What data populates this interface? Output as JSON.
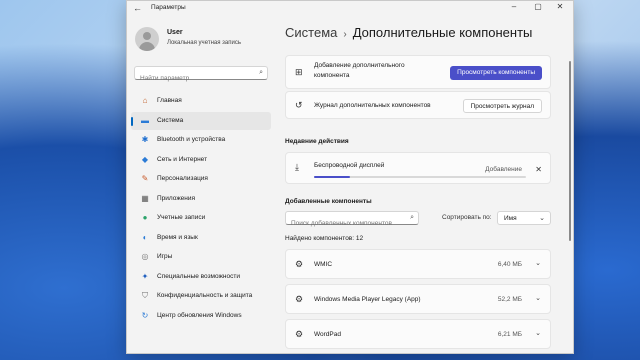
{
  "window": {
    "title": "Параметры"
  },
  "user": {
    "name": "User",
    "subtitle": "Локальная учетная запись"
  },
  "search": {
    "placeholder": "Найти параметр"
  },
  "nav": {
    "items": [
      {
        "label": "Главная",
        "icon": "home-icon",
        "glyph": "⌂",
        "color": "#c2602a"
      },
      {
        "label": "Система",
        "icon": "system-icon",
        "glyph": "▬",
        "color": "#2b7bd6",
        "active": true
      },
      {
        "label": "Bluetooth и устройства",
        "icon": "bluetooth-icon",
        "glyph": "✱",
        "color": "#1f6fd0"
      },
      {
        "label": "Сеть и Интернет",
        "icon": "wifi-icon",
        "glyph": "◆",
        "color": "#2b7bd6"
      },
      {
        "label": "Персонализация",
        "icon": "brush-icon",
        "glyph": "✎",
        "color": "#c85a2a"
      },
      {
        "label": "Приложения",
        "icon": "apps-icon",
        "glyph": "▦",
        "color": "#5a5a5a"
      },
      {
        "label": "Учетные записи",
        "icon": "accounts-icon",
        "glyph": "●",
        "color": "#2ba36b"
      },
      {
        "label": "Время и язык",
        "icon": "globe-icon",
        "glyph": "◐",
        "color": "#2b7bd6"
      },
      {
        "label": "Игры",
        "icon": "gamepad-icon",
        "glyph": "◎",
        "color": "#777777"
      },
      {
        "label": "Специальные возможности",
        "icon": "accessibility-icon",
        "glyph": "✦",
        "color": "#1f5fbf"
      },
      {
        "label": "Конфиденциальность и защита",
        "icon": "shield-icon",
        "glyph": "⛉",
        "color": "#6a6a6a"
      },
      {
        "label": "Центр обновления Windows",
        "icon": "update-icon",
        "glyph": "↻",
        "color": "#2b7bd6"
      }
    ]
  },
  "breadcrumb": {
    "parent": "Система",
    "current": "Дополнительные компоненты"
  },
  "add_card": {
    "label": "Добавление дополнительного компонента",
    "button": "Просмотреть компоненты"
  },
  "history_card": {
    "label": "Журнал дополнительных компонентов",
    "button": "Просмотреть журнал"
  },
  "recent": {
    "heading": "Недавние действия",
    "item": {
      "name": "Беспроводной дисплей",
      "status": "Добавление",
      "progress": 0.17
    }
  },
  "installed": {
    "heading": "Добавленные компоненты",
    "search_placeholder": "Поиск добавленных компонентов",
    "sort_label": "Сортировать по:",
    "sort_value": "Имя",
    "found": "Найдено компонентов: 12",
    "items": [
      {
        "name": "WMIC",
        "size": "6,40 МБ"
      },
      {
        "name": "Windows Media Player Legacy (App)",
        "size": "52,2 МБ"
      },
      {
        "name": "WordPad",
        "size": "6,21 МБ"
      }
    ]
  }
}
